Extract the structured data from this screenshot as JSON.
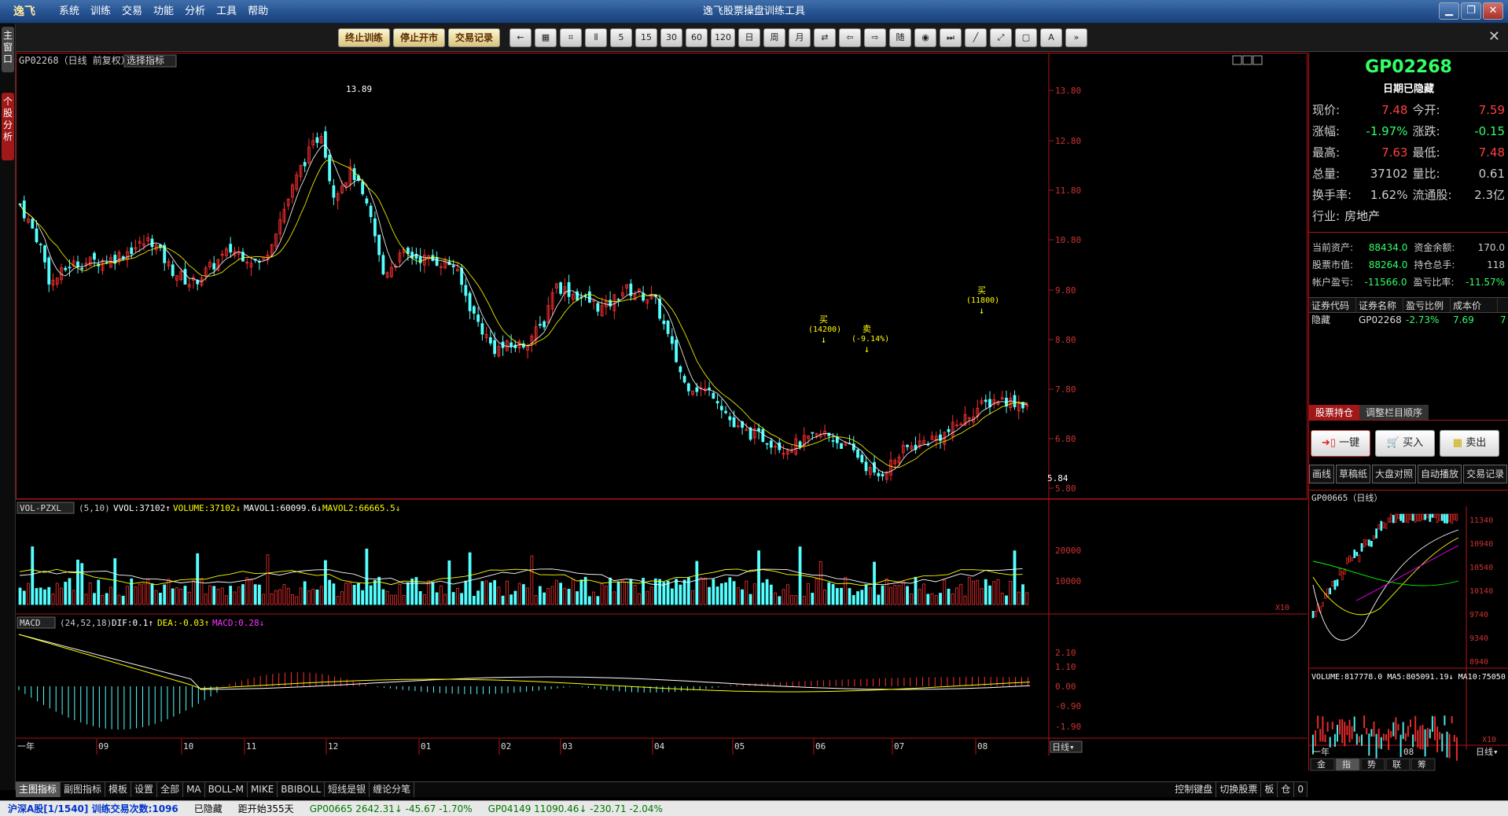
{
  "app": {
    "logo": "逸飞",
    "title": "逸飞股票操盘训练工具",
    "menu": [
      "系统",
      "训练",
      "交易",
      "功能",
      "分析",
      "工具",
      "帮助"
    ]
  },
  "toolbar": {
    "text_buttons": [
      "终止训练",
      "停止开市",
      "交易记录"
    ],
    "icon_buttons": [
      "←",
      "▦",
      "⌗",
      "⫴",
      "5",
      "15",
      "30",
      "60",
      "120",
      "日",
      "周",
      "月",
      "⇄",
      "⇦",
      "⇨",
      "随",
      "◉",
      "⏭",
      "╱",
      "⤢",
      "▢",
      "A",
      "»"
    ]
  },
  "left_tabs": [
    "主窗口",
    "个股分析"
  ],
  "main_chart": {
    "header": "GP02268（日线 前复权）",
    "indicator_select": "选择指标",
    "price_labels": [
      "13.80",
      "12.80",
      "11.80",
      "10.80",
      "9.80",
      "8.80",
      "7.80",
      "6.80",
      "5.80"
    ],
    "high_label": "13.89",
    "low_label": "5.84",
    "signals": [
      {
        "t": "买",
        "v": "(14200)"
      },
      {
        "t": "卖",
        "v": "(-9.14%)"
      },
      {
        "t": "买",
        "v": "(11800)"
      }
    ]
  },
  "vol_panel": {
    "select": "VOL-PZXL",
    "params": "(5,10)",
    "vvol": "VVOL:37102↑",
    "volume": "VOLUME:37102↓",
    "mavol1": "MAVOL1:60099.6↓",
    "mavol2": "MAVOL2:66665.5↓",
    "labels": [
      "20000",
      "10000"
    ],
    "unit": "X10"
  },
  "macd_panel": {
    "select": "MACD",
    "params": "(24,52,18)",
    "dif": "DIF:0.1↑",
    "dea": "DEA:-0.03↑",
    "macd": "MACD:0.28↓",
    "labels": [
      "2.10",
      "1.10",
      "0.00",
      "-0.90",
      "-1.90"
    ]
  },
  "x_axis": {
    "year": "一年",
    "months": [
      "09",
      "10",
      "11",
      "12",
      "01",
      "02",
      "03",
      "04",
      "05",
      "06",
      "07",
      "08"
    ],
    "period": "日线▾"
  },
  "bottom_tabs": [
    "主图指标",
    "副图指标",
    "模板",
    "设置",
    "全部",
    "MA",
    "BOLL-M",
    "MIKE",
    "BBIBOLL",
    "短线是银",
    "缠论分笔"
  ],
  "bottom_right_tabs": [
    "控制键盘",
    "切换股票",
    "板",
    "仓",
    "0"
  ],
  "right": {
    "code": "GP02268",
    "date_hidden": "日期已隐藏",
    "quote": [
      [
        "现价:",
        "7.48",
        "今开:",
        "7.59"
      ],
      [
        "涨幅:",
        "-1.97%",
        "涨跌:",
        "-0.15"
      ],
      [
        "最高:",
        "7.63",
        "最低:",
        "7.48"
      ],
      [
        "总量:",
        "37102",
        "量比:",
        "0.61"
      ],
      [
        "换手率:",
        "1.62%",
        "流通股:",
        "2.3亿"
      ]
    ],
    "industry_label": "行业:",
    "industry": "房地产",
    "account": [
      [
        "当前资产:",
        "88434.0",
        "资金余额:",
        "170.0"
      ],
      [
        "股票市值:",
        "88264.0",
        "持仓总手:",
        "118"
      ],
      [
        "帐户盈亏:",
        "-11566.0",
        "盈亏比率:",
        "-11.57%"
      ]
    ],
    "hold_headers": [
      "证券代码",
      "证券名称",
      "盈亏比例",
      "成本价"
    ],
    "hold_row": [
      "隐藏",
      "GP02268",
      "-2.73%",
      "7.69",
      "7"
    ],
    "panel_tabs": [
      "股票持仓",
      "调整栏目顺序"
    ],
    "trade_buttons": [
      "一键",
      "买入",
      "卖出"
    ],
    "small_buttons": [
      "画线",
      "草稿纸",
      "大盘对照",
      "自动播放",
      "交易记录"
    ],
    "mini_title": "GP00665（日线）",
    "mini_labels": [
      "11340",
      "10940",
      "10540",
      "10140",
      "9740",
      "9340",
      "8940"
    ],
    "mini_vol": "VOLUME:817778.0 MA5:805091.19↓ MA10:75050",
    "mini_vol_labels": [
      "50000"
    ],
    "mini_unit": "X10",
    "mini_axis": [
      "一年",
      "08"
    ],
    "mini_period": "日线▾",
    "mini_tabs": [
      "金",
      "指",
      "势",
      "联",
      "筹"
    ]
  },
  "status": [
    "沪深A股[1/1540] 训练交易次数:1096",
    "已隐藏",
    "距开始355天",
    "GP00665 2642.31↓ -45.67 -1.70%",
    "GP04149 11090.46↓ -230.71 -2.04%"
  ]
}
